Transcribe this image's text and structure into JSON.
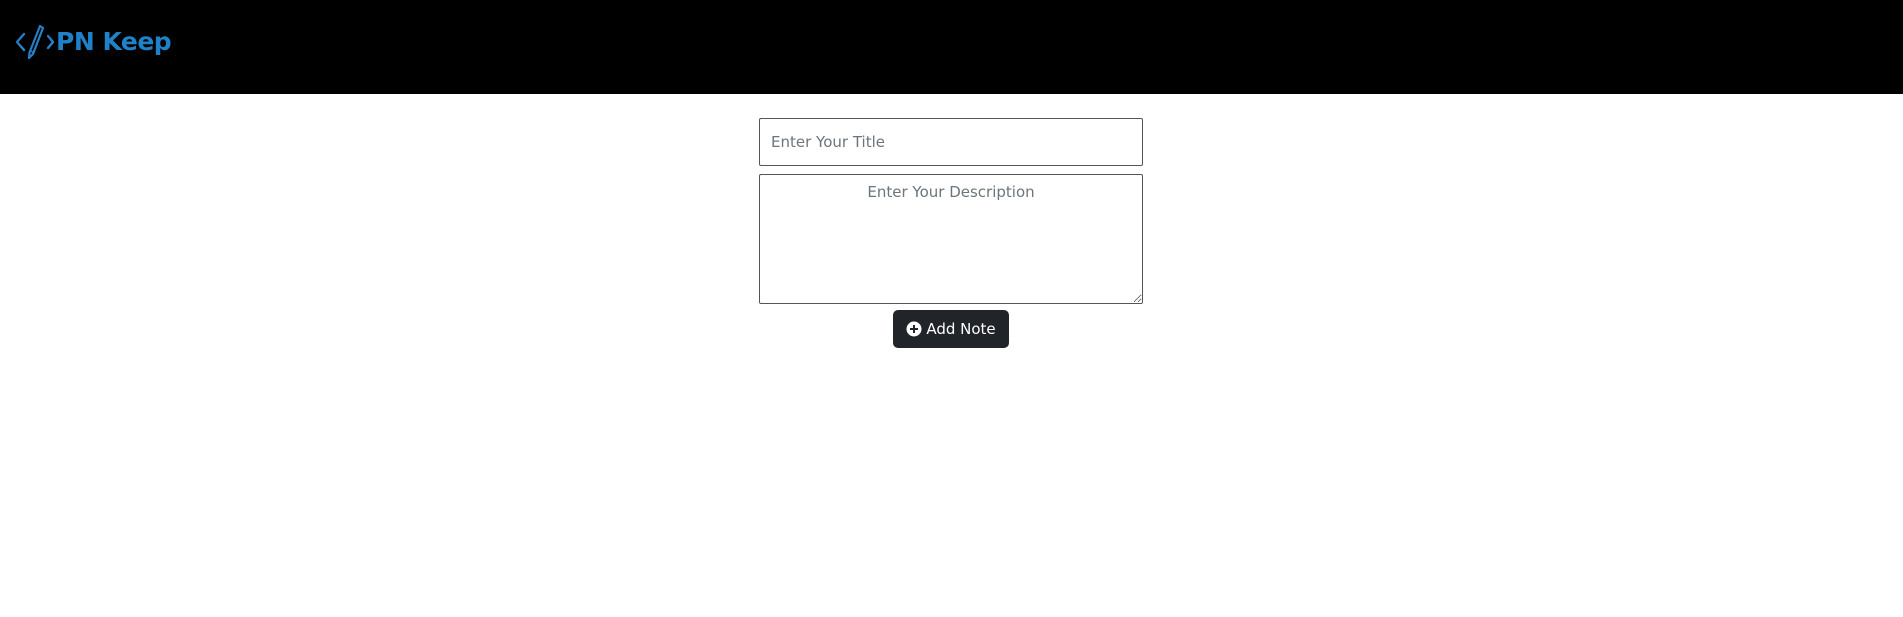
{
  "navbar": {
    "brand": {
      "name": "PN Keep",
      "icon": "code-pen-icon",
      "color": "#1f82c9"
    },
    "background": "#000000"
  },
  "note_form": {
    "title_input": {
      "value": "",
      "placeholder": "Enter Your Title"
    },
    "description_input": {
      "value": "",
      "placeholder": "Enter Your Description"
    },
    "add_button": {
      "label": "Add Note",
      "icon": "plus-circle-icon",
      "color": "#212529"
    }
  }
}
